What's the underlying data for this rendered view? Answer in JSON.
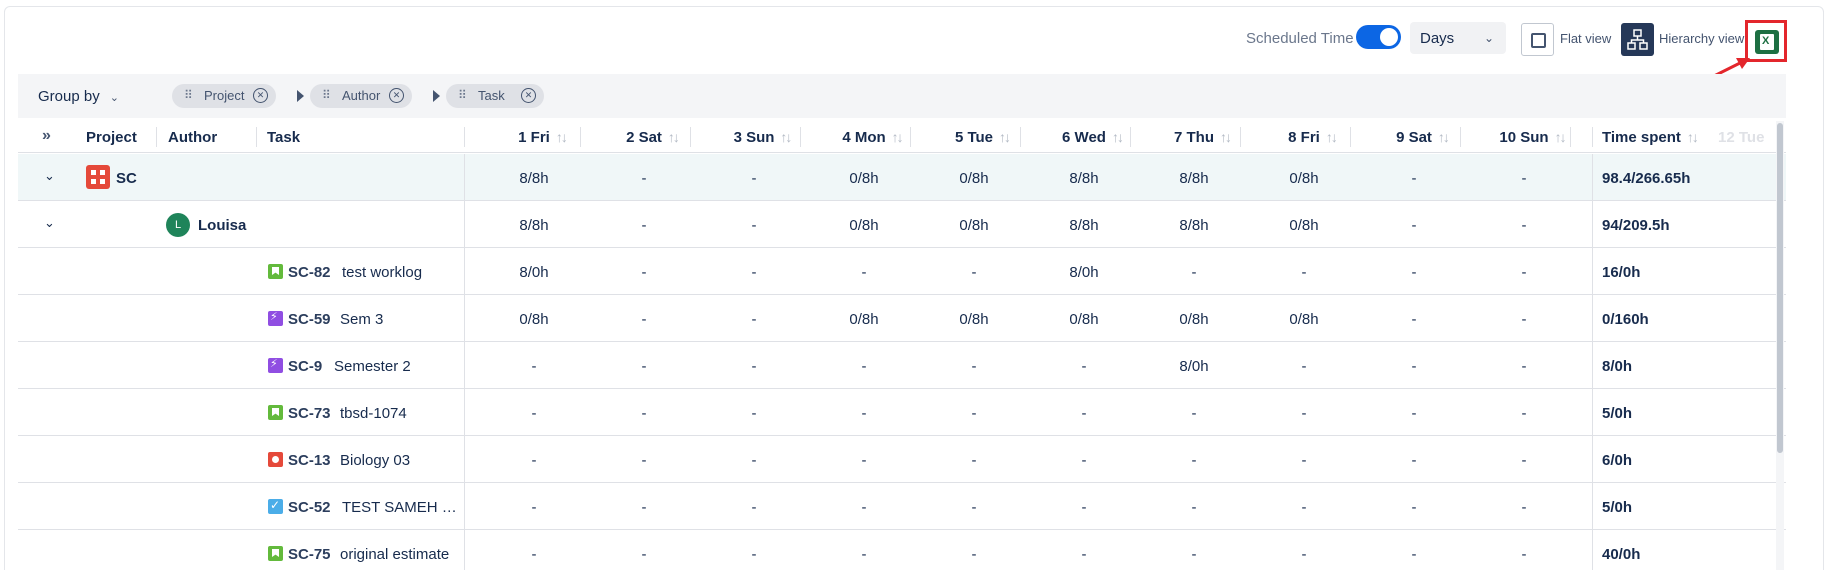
{
  "toolbar": {
    "scheduled_time_label": "Scheduled Time",
    "scheduled_time_on": true,
    "days_select_value": "Days",
    "flat_view_label": "Flat view",
    "hierarchy_view_label": "Hierarchy view",
    "accent_color": "#0c66e4",
    "excel_color": "#1d6f42"
  },
  "group_by": {
    "label": "Group by",
    "chips": [
      "Project",
      "Author",
      "Task"
    ]
  },
  "table": {
    "headers": {
      "project": "Project",
      "author": "Author",
      "task": "Task",
      "days": [
        "1 Fri",
        "2 Sat",
        "3 Sun",
        "4 Mon",
        "5 Tue",
        "6 Wed",
        "7 Thu",
        "8 Fri",
        "9 Sat",
        "10 Sun"
      ],
      "time_spent": "Time spent",
      "hidden_next": "12 Tue"
    },
    "project_row": {
      "name": "SC",
      "values": [
        "8/8h",
        "-",
        "-",
        "0/8h",
        "0/8h",
        "8/8h",
        "8/8h",
        "0/8h",
        "-",
        "-"
      ],
      "total": "98.4/266.65h"
    },
    "author_row": {
      "initial": "L",
      "name": "Louisa",
      "values": [
        "8/8h",
        "-",
        "-",
        "0/8h",
        "0/8h",
        "8/8h",
        "8/8h",
        "0/8h",
        "-",
        "-"
      ],
      "total": "94/209.5h"
    },
    "issues": [
      {
        "type": "story",
        "key": "SC-82",
        "summary": "test worklog",
        "values": [
          "8/0h",
          "-",
          "-",
          "-",
          "-",
          "8/0h",
          "-",
          "-",
          "-",
          "-"
        ],
        "total": "16/0h"
      },
      {
        "type": "epic",
        "key": "SC-59",
        "summary": "Sem 3",
        "values": [
          "0/8h",
          "-",
          "-",
          "0/8h",
          "0/8h",
          "0/8h",
          "0/8h",
          "0/8h",
          "-",
          "-"
        ],
        "total": "0/160h"
      },
      {
        "type": "epic",
        "key": "SC-9",
        "summary": "Semester 2",
        "values": [
          "-",
          "-",
          "-",
          "-",
          "-",
          "-",
          "8/0h",
          "-",
          "-",
          "-"
        ],
        "total": "8/0h"
      },
      {
        "type": "story",
        "key": "SC-73",
        "summary": "tbsd-1074",
        "values": [
          "-",
          "-",
          "-",
          "-",
          "-",
          "-",
          "-",
          "-",
          "-",
          "-"
        ],
        "total": "5/0h"
      },
      {
        "type": "bug",
        "key": "SC-13",
        "summary": "Biology 03",
        "values": [
          "-",
          "-",
          "-",
          "-",
          "-",
          "-",
          "-",
          "-",
          "-",
          "-"
        ],
        "total": "6/0h"
      },
      {
        "type": "task",
        "key": "SC-52",
        "summary": "TEST SAMEH …",
        "values": [
          "-",
          "-",
          "-",
          "-",
          "-",
          "-",
          "-",
          "-",
          "-",
          "-"
        ],
        "total": "5/0h"
      },
      {
        "type": "story",
        "key": "SC-75",
        "summary": "original estimate",
        "values": [
          "-",
          "-",
          "-",
          "-",
          "-",
          "-",
          "-",
          "-",
          "-",
          "-"
        ],
        "total": "40/0h"
      }
    ]
  }
}
